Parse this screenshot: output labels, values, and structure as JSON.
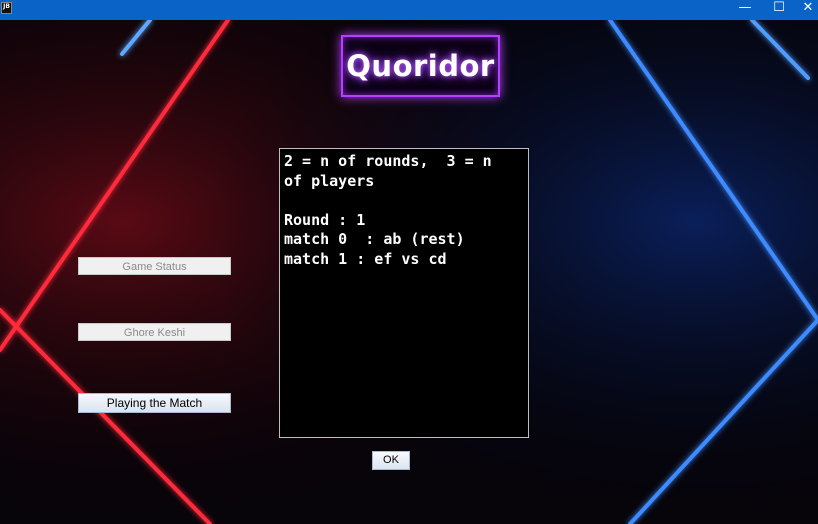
{
  "window": {
    "app_icon_text": "JB",
    "min_glyph": "—",
    "max_glyph": "☐",
    "close_glyph": "✕"
  },
  "logo": {
    "text": "Quoridor"
  },
  "buttons": {
    "status_label": "Game Status",
    "keshi_label": "Ghore Keshi",
    "play_label": "Playing the Match",
    "ok_label": "OK"
  },
  "output": {
    "text": "2 = n of rounds,  3 = n\nof players\n\nRound : 1\nmatch 0  : ab (rest)\nmatch 1 : ef vs cd"
  },
  "colors": {
    "neon_red": "#ff2a3a",
    "neon_blue": "#3d8bff",
    "neon_purple": "#b640ff",
    "titlebar": "#0a64c8"
  }
}
